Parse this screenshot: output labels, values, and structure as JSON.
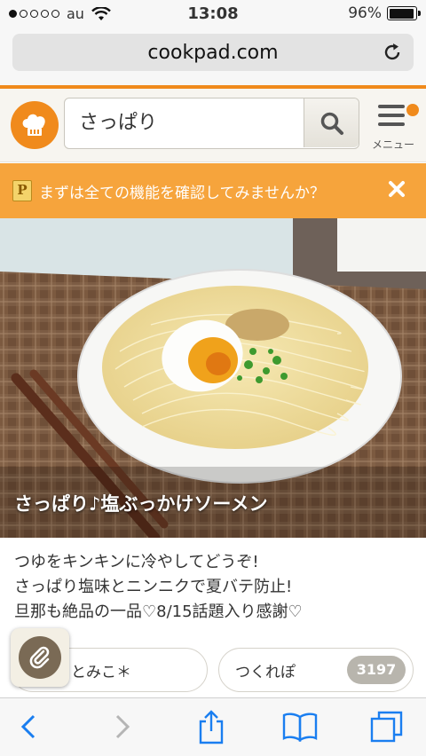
{
  "status_bar": {
    "carrier": "au",
    "time": "13:08",
    "battery_percent": "96%",
    "battery_level": 0.96,
    "signal_dots_filled": 1,
    "signal_dots_total": 5
  },
  "browser": {
    "url": "cookpad.com",
    "reload_icon": "reload-icon"
  },
  "header": {
    "logo_icon": "chef-hat-icon",
    "search_value": "さっぱり",
    "search_icon": "search-icon",
    "menu_label": "メニュー",
    "menu_badge_color": "#f08a1c"
  },
  "banner": {
    "icon_letter": "P",
    "text": "まずは全ての機能を確認してみませんか？",
    "close_icon": "close-icon",
    "color": "#f6a43c"
  },
  "recipe": {
    "title": "さっぱり♪塩ぶっかけソーメン",
    "description": [
      "つゆをキンキンに冷やしてどうぞ!",
      "さっぱり塩味とニンニクで夏バテ防止!",
      "旦那も絶品の一品♡8/15話題入り感謝♡"
    ],
    "author": "＊とみこ＊",
    "tsukurepo_label": "つくれぽ",
    "tsukurepo_count": "3197"
  },
  "toolbar": {
    "back_icon": "back-arrow-icon",
    "forward_icon": "forward-arrow-icon",
    "share_icon": "share-icon",
    "bookmarks_icon": "bookmarks-icon",
    "tabs_icon": "tabs-icon"
  },
  "colors": {
    "brand_orange": "#f08a1c",
    "link_blue": "#1a7ef0"
  }
}
